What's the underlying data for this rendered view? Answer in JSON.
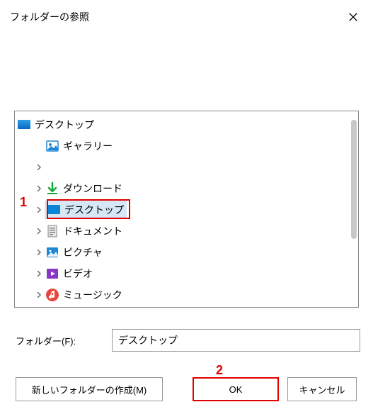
{
  "window": {
    "title": "フォルダーの参照"
  },
  "tree": {
    "root": {
      "label": "デスクトップ",
      "icon": "desktop-icon"
    },
    "items": [
      {
        "label": "ギャラリー",
        "icon": "gallery-icon",
        "expandable": false
      },
      {
        "label": "",
        "icon": "blank-icon",
        "expandable": true
      },
      {
        "label": "ダウンロード",
        "icon": "download-icon",
        "expandable": true
      },
      {
        "label": "デスクトップ",
        "icon": "desktop-icon",
        "expandable": true,
        "selected": true
      },
      {
        "label": "ドキュメント",
        "icon": "document-icon",
        "expandable": true
      },
      {
        "label": "ピクチャ",
        "icon": "pictures-icon",
        "expandable": true
      },
      {
        "label": "ビデオ",
        "icon": "video-icon",
        "expandable": true
      },
      {
        "label": "ミュージック",
        "icon": "music-icon",
        "expandable": true
      }
    ]
  },
  "folder_field": {
    "label": "フォルダー(F):",
    "value": "デスクトップ"
  },
  "buttons": {
    "new_folder": "新しいフォルダーの作成(M)",
    "ok": "OK",
    "cancel": "キャンセル"
  },
  "annotations": {
    "one": "1",
    "two": "2"
  }
}
